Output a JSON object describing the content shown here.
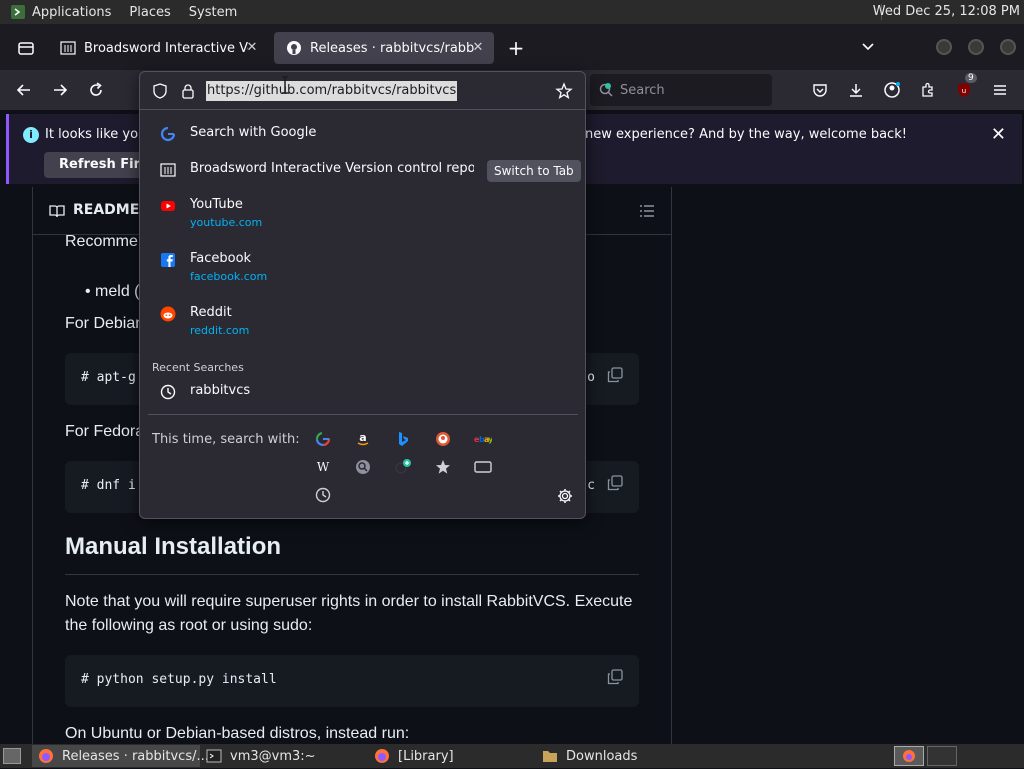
{
  "top_panel": {
    "menus": [
      "Applications",
      "Places",
      "System"
    ],
    "clock": "Wed Dec 25, 12:08 PM"
  },
  "tabs": [
    {
      "title": "Broadsword Interactive Version control repos",
      "icon": "building-icon",
      "close": "✕"
    },
    {
      "title": "Releases · rabbitvcs/rabbitvcs",
      "icon": "github-icon",
      "close": "✕"
    }
  ],
  "new_tab": "+",
  "navbar": {
    "search_placeholder": "Search",
    "extension_badge": "9"
  },
  "urlbar": {
    "url": "https://github.com/rabbitvcs/rabbitvcs"
  },
  "notification": {
    "message_left": "It looks like you h",
    "message_right": "new experience? And by the way, welcome back!",
    "refresh_label": "Refresh Firefox…",
    "close": "✕"
  },
  "dropdown": {
    "rows": [
      {
        "title": "Search with Google",
        "icon": "google-icon"
      },
      {
        "title": "Broadsword Interactive Version control repos",
        "icon": "building-icon",
        "action": "Switch to Tab"
      },
      {
        "title": "YouTube",
        "subtitle": "youtube.com",
        "icon": "youtube-icon"
      },
      {
        "title": "Facebook",
        "subtitle": "facebook.com",
        "icon": "facebook-icon"
      },
      {
        "title": "Reddit",
        "subtitle": "reddit.com",
        "icon": "reddit-icon"
      }
    ],
    "recent_label": "Recent Searches",
    "recent": [
      {
        "title": "rabbitvcs",
        "icon": "clock-icon"
      }
    ],
    "oneoff_label": "This time, search with:",
    "engines": [
      "google-icon",
      "amazon-icon",
      "bing-icon",
      "duckduckgo-icon",
      "ebay-icon",
      "wikipedia-icon",
      "search-engine-icon",
      "add-engine-icon",
      "bookmarks-icon",
      "tabs-icon",
      "history-icon"
    ]
  },
  "page": {
    "readme_label": "README",
    "recommended": "Recomme",
    "bullet": "meld (",
    "for_debian": "For Debian",
    "code1": "# apt-g",
    "code1_tail": "o",
    "for_fedora": "For Fedora",
    "code2": "# dnf i",
    "code2_tail": "c",
    "heading": "Manual Installation",
    "note_line1": "Note that you will require superuser rights in order to install RabbitVCS. Execute",
    "note_line2": "the following as root or using sudo:",
    "code3": "# python setup.py install",
    "ubuntu": "On Ubuntu or Debian-based distros, instead run:"
  },
  "taskbar": {
    "items": [
      {
        "label": "Releases · rabbitvcs/...",
        "icon": "firefox-icon"
      },
      {
        "label": "vm3@vm3:~",
        "icon": "terminal-icon"
      },
      {
        "label": "[Library]",
        "icon": "firefox-icon"
      },
      {
        "label": "Downloads",
        "icon": "folder-icon"
      }
    ]
  },
  "colors": {
    "accent": "#9059ff",
    "link": "#00b3f4",
    "page_bg": "#0d1117"
  }
}
